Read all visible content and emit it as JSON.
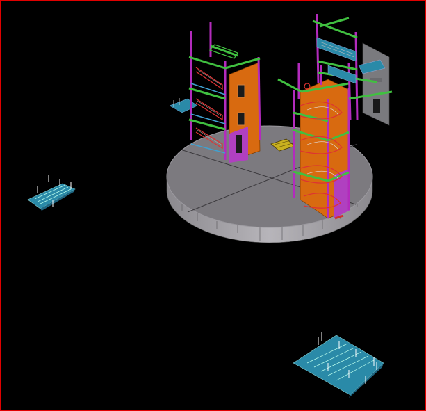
{
  "viewport": {
    "background": "#000000",
    "border_color": "#e00000"
  },
  "model": {
    "platform_fill": "#7d7b80",
    "platform_edge": "#a9a7ad",
    "beam_magenta": "#a020a0",
    "beam_green": "#40c040",
    "panel_orange": "#e06a10",
    "panel_pink": "#b040c0",
    "stair_teal": "#2a8aa8",
    "stair_red": "#d03030",
    "structure_gray": "#7a7a7e"
  }
}
